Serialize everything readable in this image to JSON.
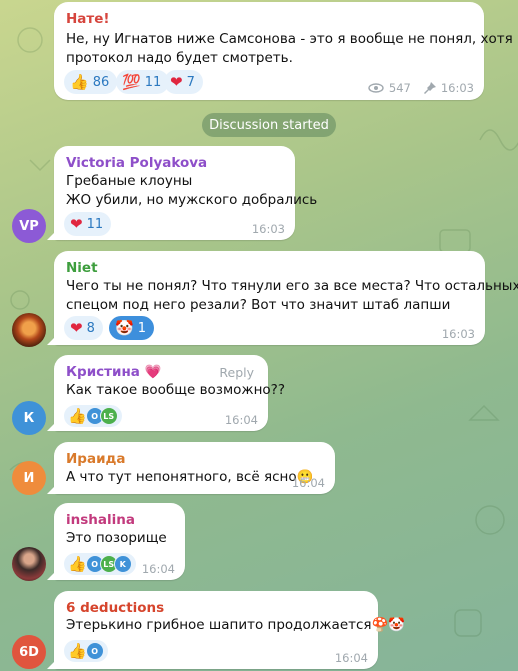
{
  "post": {
    "sender": "Нате!",
    "text_lines": [
      "Не, ну Игнатов ниже Самсонова - это я вообще не понял, хотя",
      "протокол надо будет смотреть."
    ],
    "reactions": [
      {
        "icon": "thumbs-up",
        "emoji": "👍",
        "count": "86"
      },
      {
        "icon": "hundred",
        "emoji": "💯",
        "count": "11"
      },
      {
        "icon": "heart",
        "emoji": "❤",
        "count": "7"
      }
    ],
    "views": "547",
    "time": "16:03"
  },
  "service_message": "Discussion started",
  "comments": [
    {
      "sender": "Victoria Polyakova",
      "sender_color": "#8e4fc9",
      "avatar_text": "VP",
      "avatar_color": "#8c5ad6",
      "text_lines": [
        "Гребаные клоуны",
        "ЖО убили, но мужского добрались"
      ],
      "reactions": [
        {
          "emoji": "❤",
          "count": "11"
        }
      ],
      "time": "16:03"
    },
    {
      "sender": "Niet",
      "sender_color": "#3e9e3e",
      "text_lines": [
        "Чего ты не понял? Что тянули его за все места? Что остальных",
        "спецом под него резали? Вот что значит штаб лапши"
      ],
      "reactions": [
        {
          "emoji": "❤",
          "count": "8"
        },
        {
          "emoji": "🤡",
          "count": "1"
        }
      ],
      "time": "16:03"
    },
    {
      "sender": "Кристина",
      "sender_badge": "💗",
      "sender_color": "#8e4fc9",
      "avatar_text": "К",
      "avatar_color": "#3f92d8",
      "reply_label": "Reply",
      "text_lines": [
        "Как такое вообще возможно??"
      ],
      "mini_avatars": [
        "O",
        "LS"
      ],
      "time": "16:04"
    },
    {
      "sender": "Ираида",
      "sender_color": "#d97a2b",
      "avatar_text": "И",
      "avatar_color": "#ef8c3c",
      "text_lines": [
        "А что тут непонятного, всё ясно😬"
      ],
      "time": "16:04"
    },
    {
      "sender": "inshalina",
      "sender_color": "#c23a7d",
      "text_lines": [
        "Это позорище"
      ],
      "mini_avatars": [
        "O",
        "LS",
        "K"
      ],
      "time": "16:04"
    },
    {
      "sender": "6 deductions",
      "sender_color": "#d6452d",
      "avatar_text": "6D",
      "avatar_color": "#e0553e",
      "text_lines": [
        "Этерькино грибное шапито продолжается🍄🤡"
      ],
      "mini_avatars": [
        "O"
      ],
      "time": "16:04"
    }
  ],
  "colors": {
    "link": "#2c79c0",
    "heart": "#e0263f",
    "bubble": "#ffffff"
  }
}
